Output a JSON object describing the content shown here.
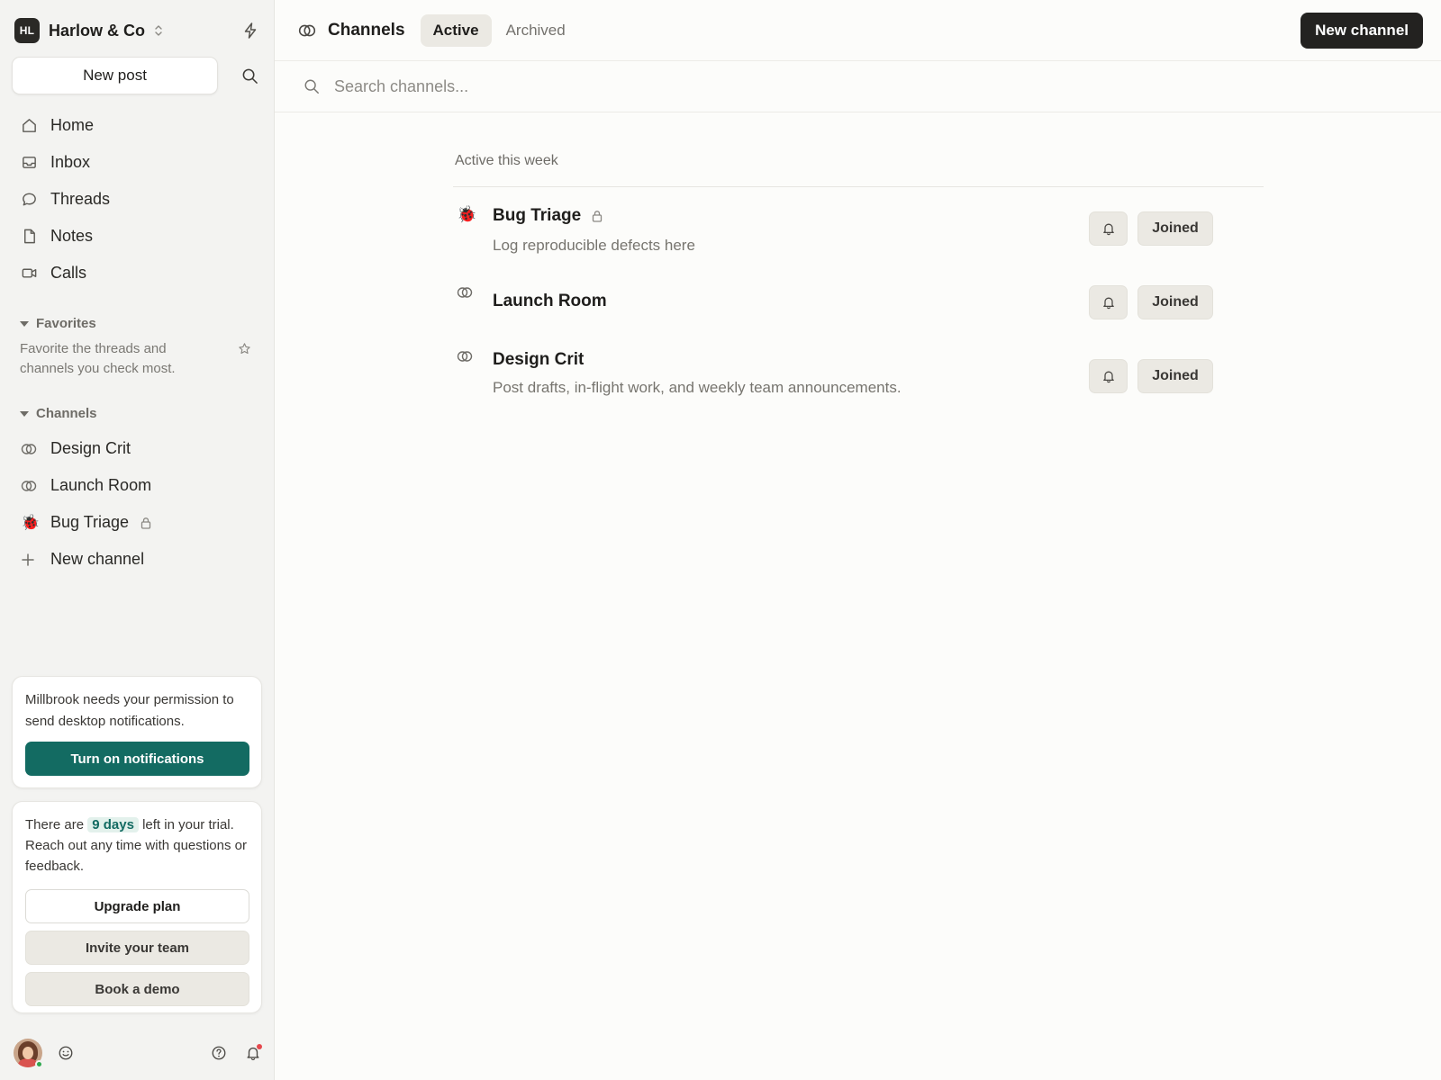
{
  "workspace": {
    "initials": "HL",
    "name": "Harlow & Co"
  },
  "sidebar": {
    "new_post_label": "New post",
    "nav": [
      {
        "label": "Home",
        "icon": "home-icon"
      },
      {
        "label": "Inbox",
        "icon": "inbox-icon"
      },
      {
        "label": "Threads",
        "icon": "chat-bubble-icon"
      },
      {
        "label": "Notes",
        "icon": "document-icon"
      },
      {
        "label": "Calls",
        "icon": "video-icon"
      }
    ],
    "favorites": {
      "title": "Favorites",
      "empty_text": "Favorite the threads and channels you check most."
    },
    "channels": {
      "title": "Channels",
      "items": [
        {
          "label": "Design Crit",
          "icon": "channel-rings-icon"
        },
        {
          "label": "Launch Room",
          "icon": "channel-rings-icon"
        },
        {
          "label": "Bug Triage",
          "icon": "ladybug-icon",
          "private": true
        }
      ],
      "new_label": "New channel"
    },
    "notification_card": {
      "text": "Millbrook needs your permission to send desktop notifications.",
      "button": "Turn on notifications"
    },
    "trial_card": {
      "text_before": "There are",
      "days": "9 days",
      "text_after": "left in your trial. Reach out any time with questions or feedback.",
      "upgrade": "Upgrade plan",
      "invite": "Invite your team",
      "demo": "Book a demo"
    }
  },
  "header": {
    "title": "Channels",
    "tabs": [
      {
        "label": "Active",
        "active": true
      },
      {
        "label": "Archived",
        "active": false
      }
    ],
    "new_channel": "New channel"
  },
  "search": {
    "placeholder": "Search channels..."
  },
  "list": {
    "section_title": "Active this week",
    "rows": [
      {
        "name": "Bug Triage",
        "icon": "ladybug-icon",
        "private": true,
        "description": "Log reproducible defects here",
        "status": "Joined"
      },
      {
        "name": "Launch Room",
        "icon": "channel-rings-icon",
        "private": false,
        "description": "",
        "status": "Joined"
      },
      {
        "name": "Design Crit",
        "icon": "channel-rings-icon",
        "private": false,
        "description": "Post drafts, in-flight work, and weekly team announcements.",
        "status": "Joined"
      }
    ]
  },
  "colors": {
    "accent": "#136b62",
    "primary_dark": "#232220",
    "sidebar_bg": "#f3f3f1"
  }
}
